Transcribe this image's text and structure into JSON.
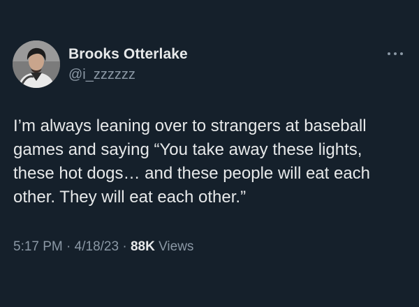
{
  "author": {
    "display_name": "Brooks Otterlake",
    "handle": "@i_zzzzzz"
  },
  "tweet": {
    "text_lines": [
      "I’m always leaning over to strangers at baseball",
      "games and saying “You take away these lights,",
      "these hot dogs… and these people will eat each",
      "other. They will eat each other.”"
    ]
  },
  "meta": {
    "time": "5:17 PM",
    "separator": "·",
    "date": "4/18/23",
    "views_count": "88K",
    "views_label": "Views"
  },
  "icons": {
    "more": "more-options-icon",
    "avatar": "user-avatar"
  },
  "colors": {
    "background": "#15202b",
    "text_primary": "#e7e9ea",
    "text_secondary": "#8b98a5"
  }
}
